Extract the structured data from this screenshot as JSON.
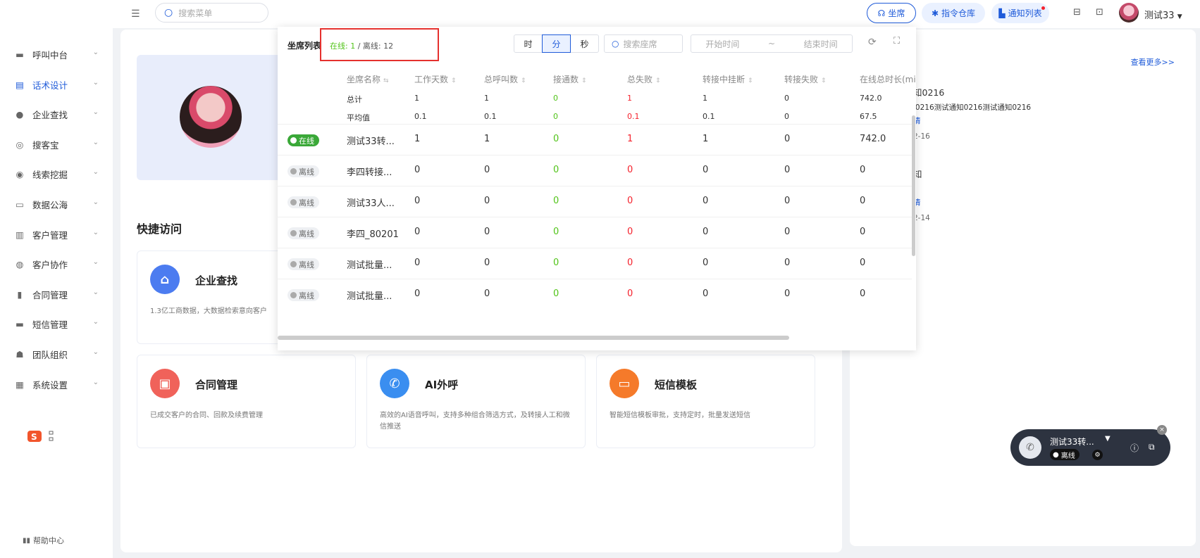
{
  "topbar": {
    "search_placeholder": "搜索菜单",
    "seat_label": "坐席",
    "cmd_label": "指令仓库",
    "notice_label": "通知列表",
    "user_name": "测试33"
  },
  "sidebar": {
    "items": [
      {
        "label": "呼叫中台",
        "icon": "monitor-icon"
      },
      {
        "label": "话术设计",
        "icon": "script-icon"
      },
      {
        "label": "企业查找",
        "icon": "bulb-icon"
      },
      {
        "label": "搜客宝",
        "icon": "search-customer-icon"
      },
      {
        "label": "线索挖掘",
        "icon": "target-icon"
      },
      {
        "label": "数据公海",
        "icon": "chart-icon"
      },
      {
        "label": "客户管理",
        "icon": "customer-icon"
      },
      {
        "label": "客户协作",
        "icon": "collab-icon"
      },
      {
        "label": "合同管理",
        "icon": "contract-icon"
      },
      {
        "label": "短信管理",
        "icon": "sms-icon"
      },
      {
        "label": "团队组织",
        "icon": "team-icon"
      },
      {
        "label": "系统设置",
        "icon": "settings-icon"
      }
    ],
    "help": "帮助中心"
  },
  "main": {
    "section_title": "快捷访问",
    "cards": [
      {
        "title": "企业查找",
        "desc": "1.3亿工商数据，大数据检索意向客户",
        "color": "#4c7cf0"
      },
      {
        "title": "合同管理",
        "desc": "已成交客户的合同、回款及续费管理",
        "color": "#f0625a"
      },
      {
        "title": "AI外呼",
        "desc": "高效的AI语音呼叫，支持多种组合筛选方式，及转接人工和微信推送",
        "color": "#3a8ef0"
      },
      {
        "title": "短信模板",
        "desc": "智能短信模板审批，支持定时，批量发送短信",
        "color": "#f57a2a"
      }
    ]
  },
  "right_panel": {
    "see_more": "查看更多>>",
    "lines": [
      "知0216",
      "l0216测试通知0216测试通知0216",
      "情",
      "2-16",
      "知",
      "l",
      "情",
      "2-14"
    ]
  },
  "seat_list": {
    "title": "坐席列表",
    "online_text": "在线: 1",
    "offline_text": "/ 离线: 12",
    "seg": [
      "时",
      "分",
      "秒"
    ],
    "search_placeholder": "搜索座席",
    "start_placeholder": "开始时间",
    "range_sep": "~",
    "end_placeholder": "结束时间",
    "headers": [
      "坐席名称",
      "工作天数",
      "总呼叫数",
      "接通数",
      "总失败",
      "转接中挂断",
      "转接失败",
      "在线总时长(mi"
    ],
    "total_row": {
      "label": "总计",
      "values": [
        "1",
        "1",
        "0",
        "1",
        "1",
        "0",
        "742.0"
      ]
    },
    "avg_row": {
      "label": "平均值",
      "values": [
        "0.1",
        "0.1",
        "0",
        "0.1",
        "0.1",
        "0",
        "67.5"
      ]
    },
    "rows": [
      {
        "status": "在线",
        "name": "测试33转...",
        "values": [
          "1",
          "1",
          "0",
          "1",
          "1",
          "0",
          "742.0"
        ]
      },
      {
        "status": "离线",
        "name": "李四转接...",
        "values": [
          "0",
          "0",
          "0",
          "0",
          "0",
          "0",
          "0"
        ]
      },
      {
        "status": "离线",
        "name": "测试33人...",
        "values": [
          "0",
          "0",
          "0",
          "0",
          "0",
          "0",
          "0"
        ]
      },
      {
        "status": "离线",
        "name": "李四_80201",
        "values": [
          "0",
          "0",
          "0",
          "0",
          "0",
          "0",
          "0"
        ]
      },
      {
        "status": "离线",
        "name": "测试批量...",
        "values": [
          "0",
          "0",
          "0",
          "0",
          "0",
          "0",
          "0"
        ]
      },
      {
        "status": "离线",
        "name": "测试批量...",
        "values": [
          "0",
          "0",
          "0",
          "0",
          "0",
          "0",
          "0"
        ]
      }
    ]
  },
  "call_widget": {
    "name": "测试33转...",
    "status": "离线"
  }
}
